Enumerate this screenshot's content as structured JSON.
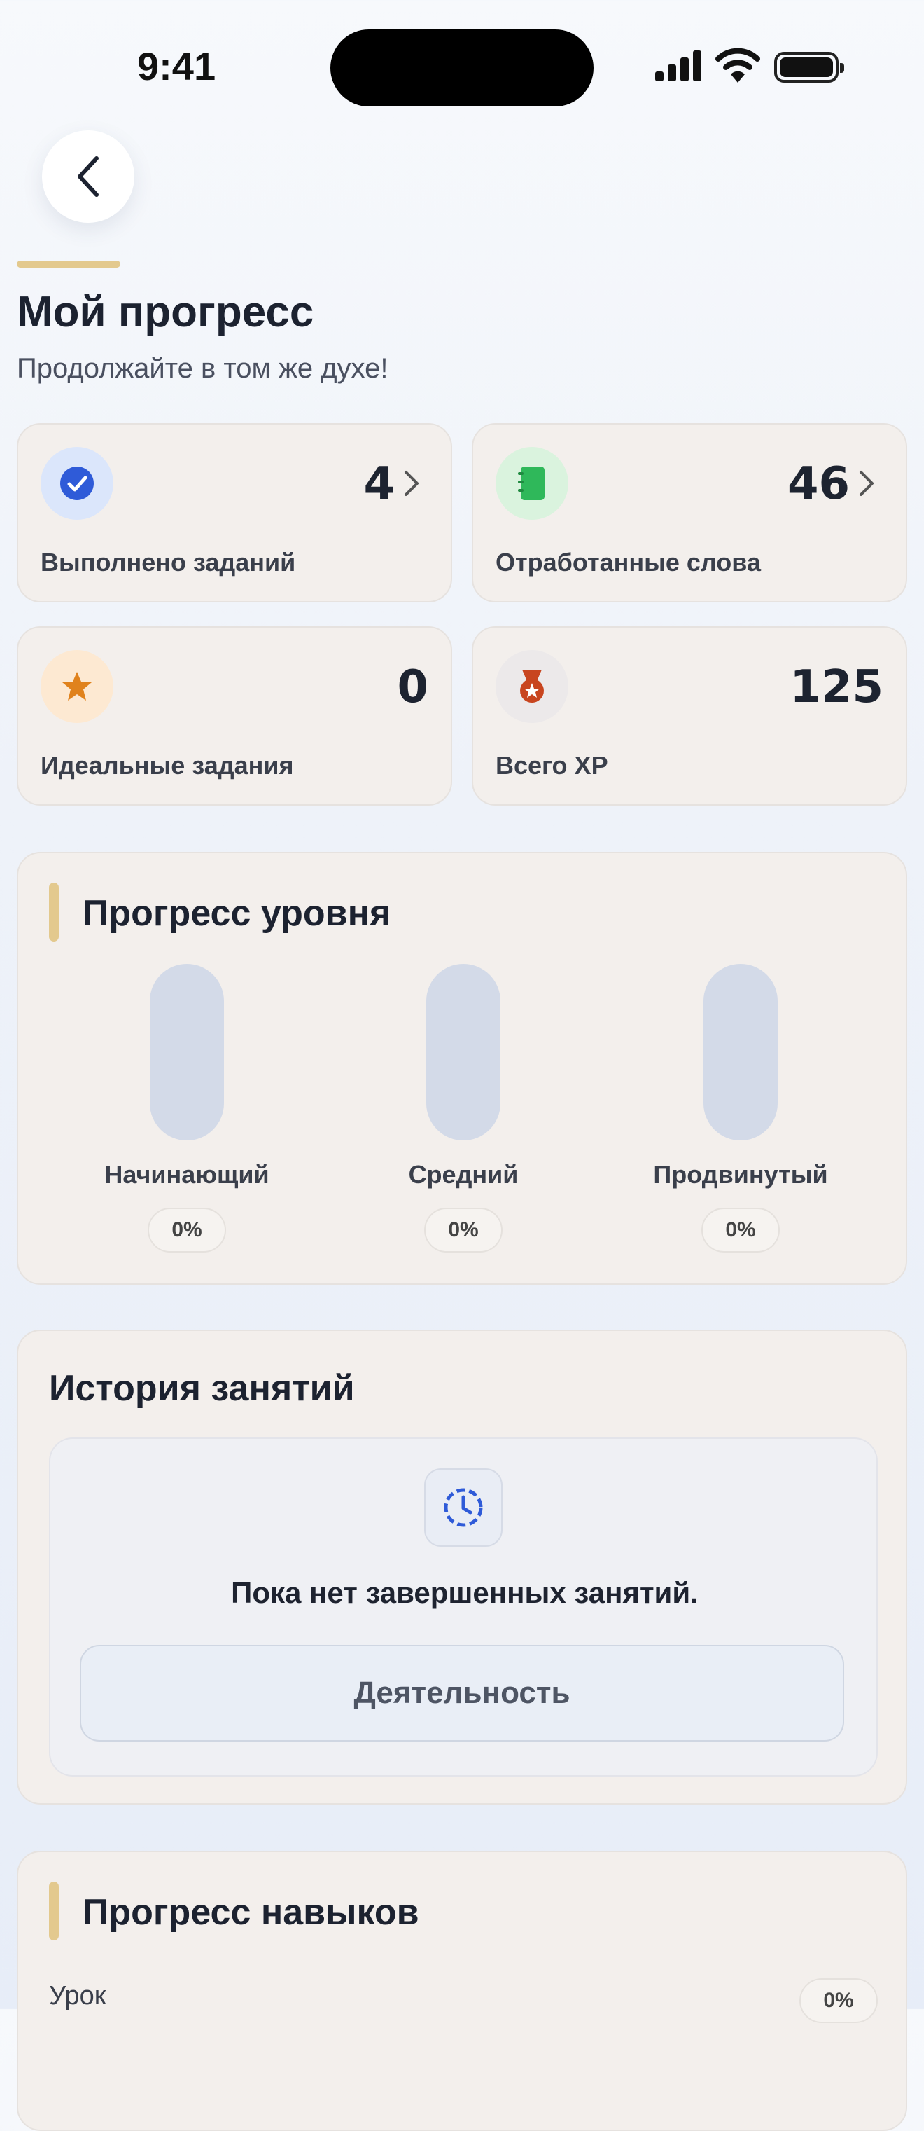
{
  "status_bar": {
    "time": "9:41"
  },
  "header": {
    "title": "Мой прогресс",
    "subtitle": "Продолжайте в том же духе!"
  },
  "stats": [
    {
      "value": "4",
      "label": "Выполнено заданий",
      "icon": "check-circle-icon",
      "color": "#2f5bd8"
    },
    {
      "value": "46",
      "label": "Отработанные слова",
      "icon": "notebook-icon",
      "color": "#2fb85a"
    },
    {
      "value": "0",
      "label": "Идеальные задания",
      "icon": "star-icon",
      "color": "#e0821c"
    },
    {
      "value": "125",
      "label": "Всего XP",
      "icon": "medal-icon",
      "color": "#c8451f"
    }
  ],
  "level_progress": {
    "title": "Прогресс уровня",
    "levels": [
      {
        "label": "Начинающий",
        "percent": "0%"
      },
      {
        "label": "Средний",
        "percent": "0%"
      },
      {
        "label": "Продвинутый",
        "percent": "0%"
      }
    ]
  },
  "history": {
    "title": "История занятий",
    "empty_message": "Пока нет завершенных занятий.",
    "button_label": "Деятельность"
  },
  "skills": {
    "title": "Прогресс навыков",
    "rows": [
      {
        "label": "Урок",
        "percent": "0%"
      }
    ]
  },
  "colors": {
    "accent_gold": "#e3c98e",
    "card_bg": "#f3efec",
    "pill_bg": "#d3dae8"
  }
}
